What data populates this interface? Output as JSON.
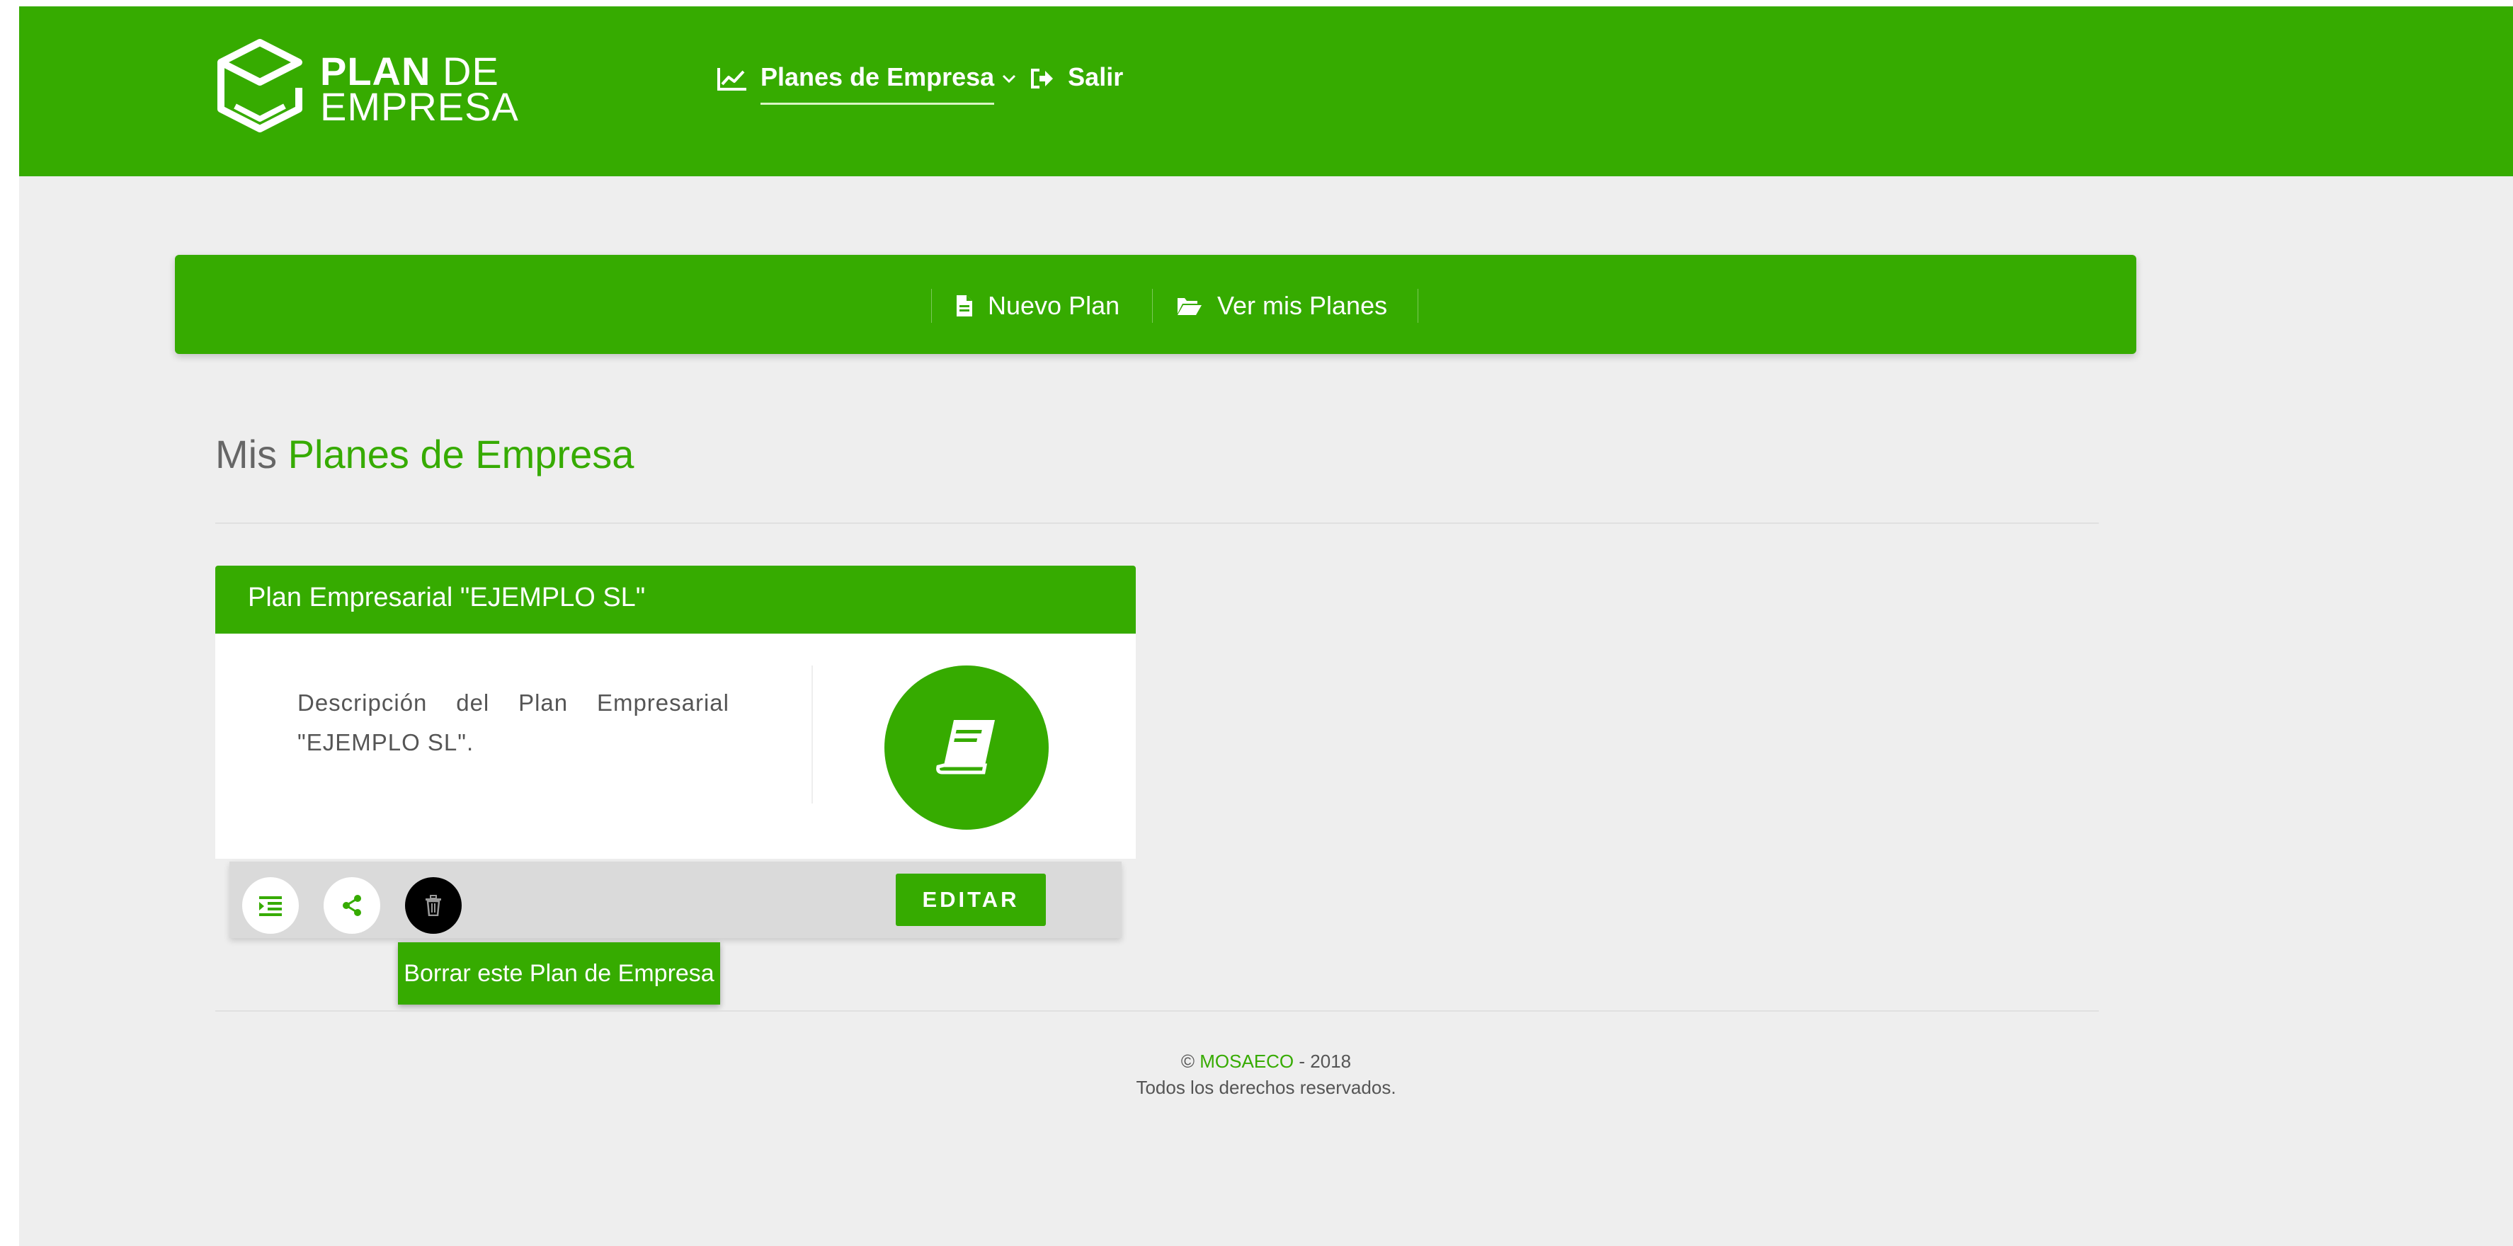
{
  "header": {
    "logo": {
      "line1_bold": "PLAN",
      "line1_light": "DE",
      "line2": "EMPRESA"
    },
    "nav": {
      "planes_label": "Planes de Empresa",
      "salir_label": "Salir"
    }
  },
  "subnav": {
    "nuevo_plan": "Nuevo Plan",
    "ver_mis_planes": "Ver mis Planes"
  },
  "page_title": {
    "prefix": "Mis",
    "highlight": "Planes de Empresa"
  },
  "card": {
    "title": "Plan Empresarial \"EJEMPLO SL\"",
    "description": "Descripción del Plan Empresarial \"EJEMPLO SL\".",
    "edit_label": "EDITAR",
    "delete_tooltip": "Borrar este Plan de Empresa",
    "icons": [
      "indent-icon",
      "share-icon",
      "trash-icon",
      "book-icon"
    ]
  },
  "footer": {
    "copyright_symbol": "©",
    "brand": "MOSAECO",
    "year_text": "- 2018",
    "rights": "Todos los derechos reservados."
  },
  "colors": {
    "brand_green": "#36ab00",
    "background": "#eeeeee"
  }
}
